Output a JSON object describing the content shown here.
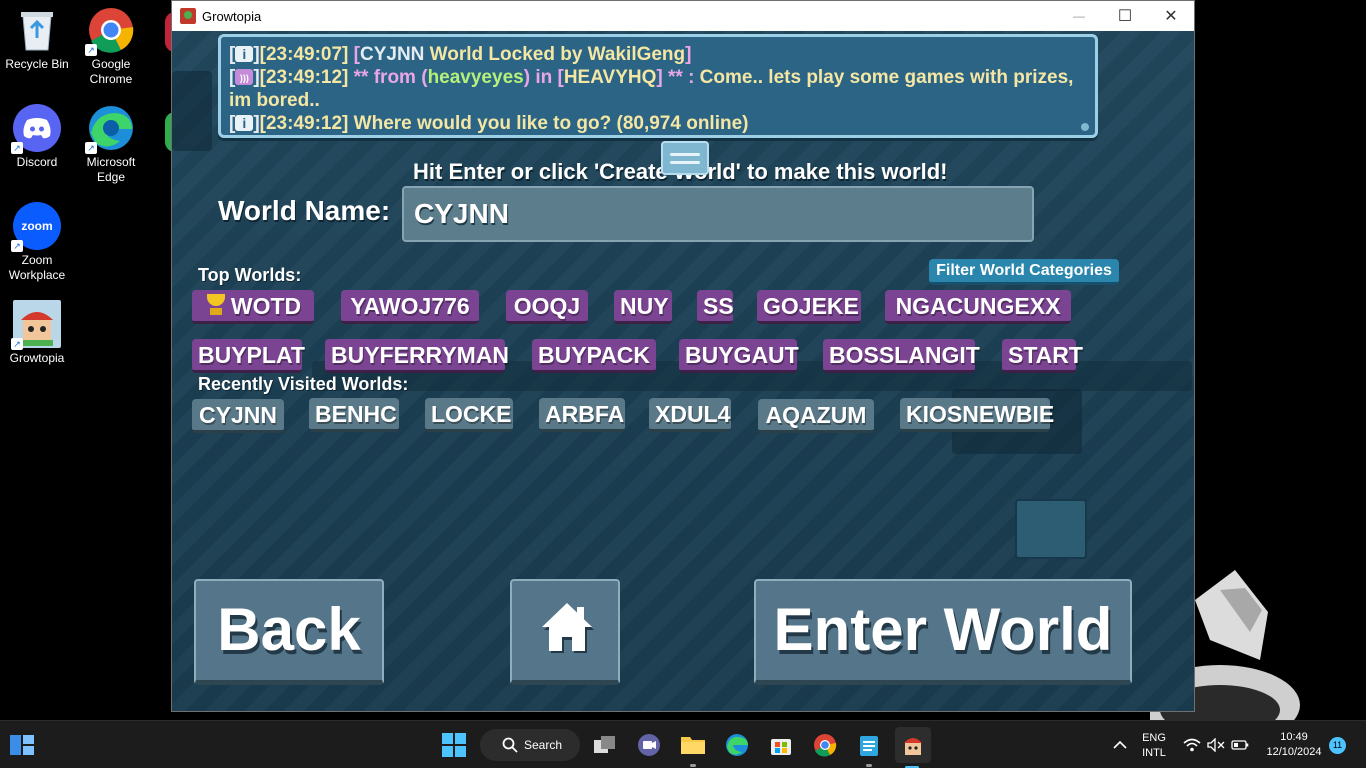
{
  "desktop": {
    "icons": [
      {
        "label": "Recycle Bin"
      },
      {
        "label": "Google Chrome"
      },
      {
        "label": "Discord"
      },
      {
        "label": "Microsoft Edge"
      },
      {
        "label": "Zoom Workplace"
      },
      {
        "label": "Growtopia"
      }
    ]
  },
  "window": {
    "title": "Growtopia",
    "minimize": "—",
    "maximize": "☐",
    "close": "✕"
  },
  "chat": {
    "line1": {
      "time": "[23:49:07]",
      "b1": "[",
      "world": "CYJNN",
      "msg": " World Locked by WakilGeng",
      "b2": "]"
    },
    "line2": {
      "time": "[23:49:12]",
      "pre": "  ** from (",
      "user": "heavyeyes",
      "mid": ") in [",
      "loc": "HEAVYHQ",
      "post": "] ** : ",
      "text": "Come.. lets play some games with prizes, im bored.."
    },
    "line3": {
      "time": "[23:49:12]",
      "text": " Where would you like to go? (80,974 online)"
    }
  },
  "hint": "Hit Enter or click 'Create World' to make this world!",
  "world_name": {
    "label": "World Name:",
    "value": "CYJNN"
  },
  "top_worlds": {
    "label": "Top Worlds:",
    "filter_label": "Filter World Categories",
    "items": [
      "WOTD",
      "YAWOJ776",
      "OOQJ",
      "NUY",
      "SS",
      "GOJEKE",
      "NGACUNGEXX",
      "BUYPLAT",
      "BUYFERRYMAN",
      "BUYPACK",
      "BUYGAUT",
      "BOSSLANGIT",
      "START"
    ]
  },
  "recent_worlds": {
    "label": "Recently Visited Worlds:",
    "items": [
      "CYJNN",
      "BENHC",
      "LOCKE",
      "ARBFA",
      "XDUL4",
      "AQAZUM",
      "KIOSNEWBIE"
    ]
  },
  "buttons": {
    "back": "Back",
    "enter": "Enter World",
    "home_icon": "home-icon"
  },
  "taskbar": {
    "search": "Search",
    "lang1": "ENG",
    "lang2": "INTL",
    "time": "10:49",
    "date": "12/10/2024",
    "notifications": "11"
  },
  "colors": {
    "top_world": "#7b4492",
    "recent_world": "#5a7988",
    "chat_bg": "#2b6484",
    "game_bg": "#1e4459"
  }
}
